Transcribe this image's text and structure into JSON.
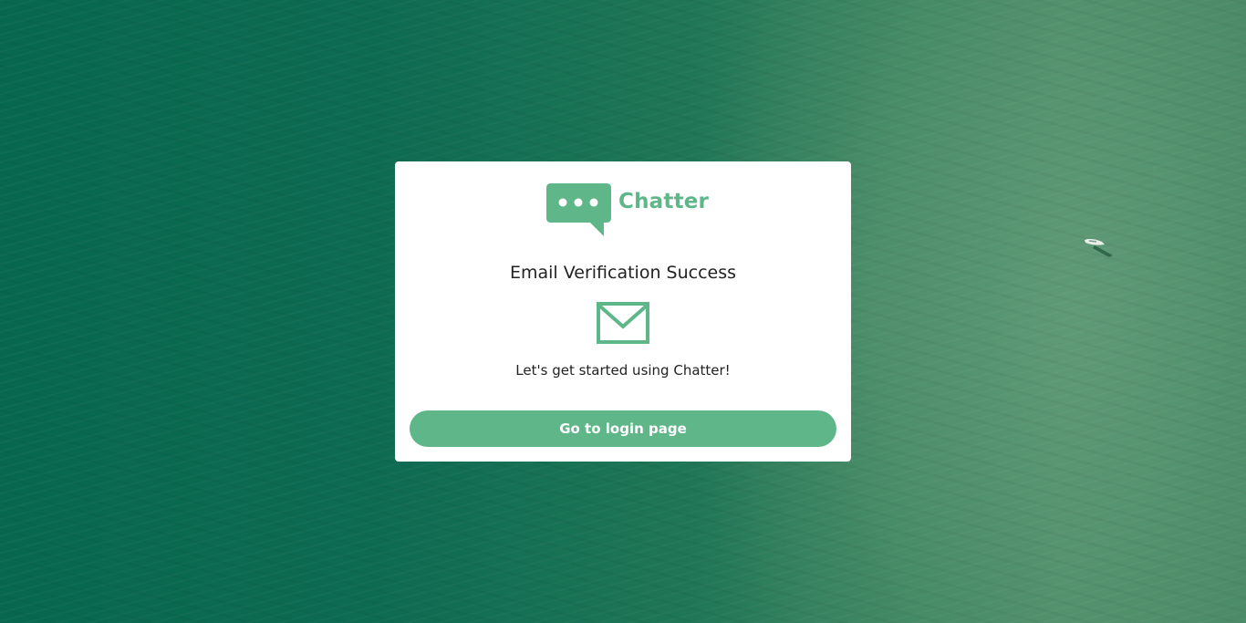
{
  "colors": {
    "accent": "#5fb689",
    "card_background": "#ffffff",
    "text": "#222222",
    "background_water": "#0f6b52"
  },
  "background": {
    "description_icon": "aerial-ocean-photo"
  },
  "card": {
    "logo": {
      "icon": "chat-bubble-icon",
      "text": "Chatter"
    },
    "title": "Email Verification Success",
    "envelope_icon": "envelope-icon",
    "subtitle": "Let's get started using Chatter!",
    "login_button_label": "Go to login page"
  }
}
